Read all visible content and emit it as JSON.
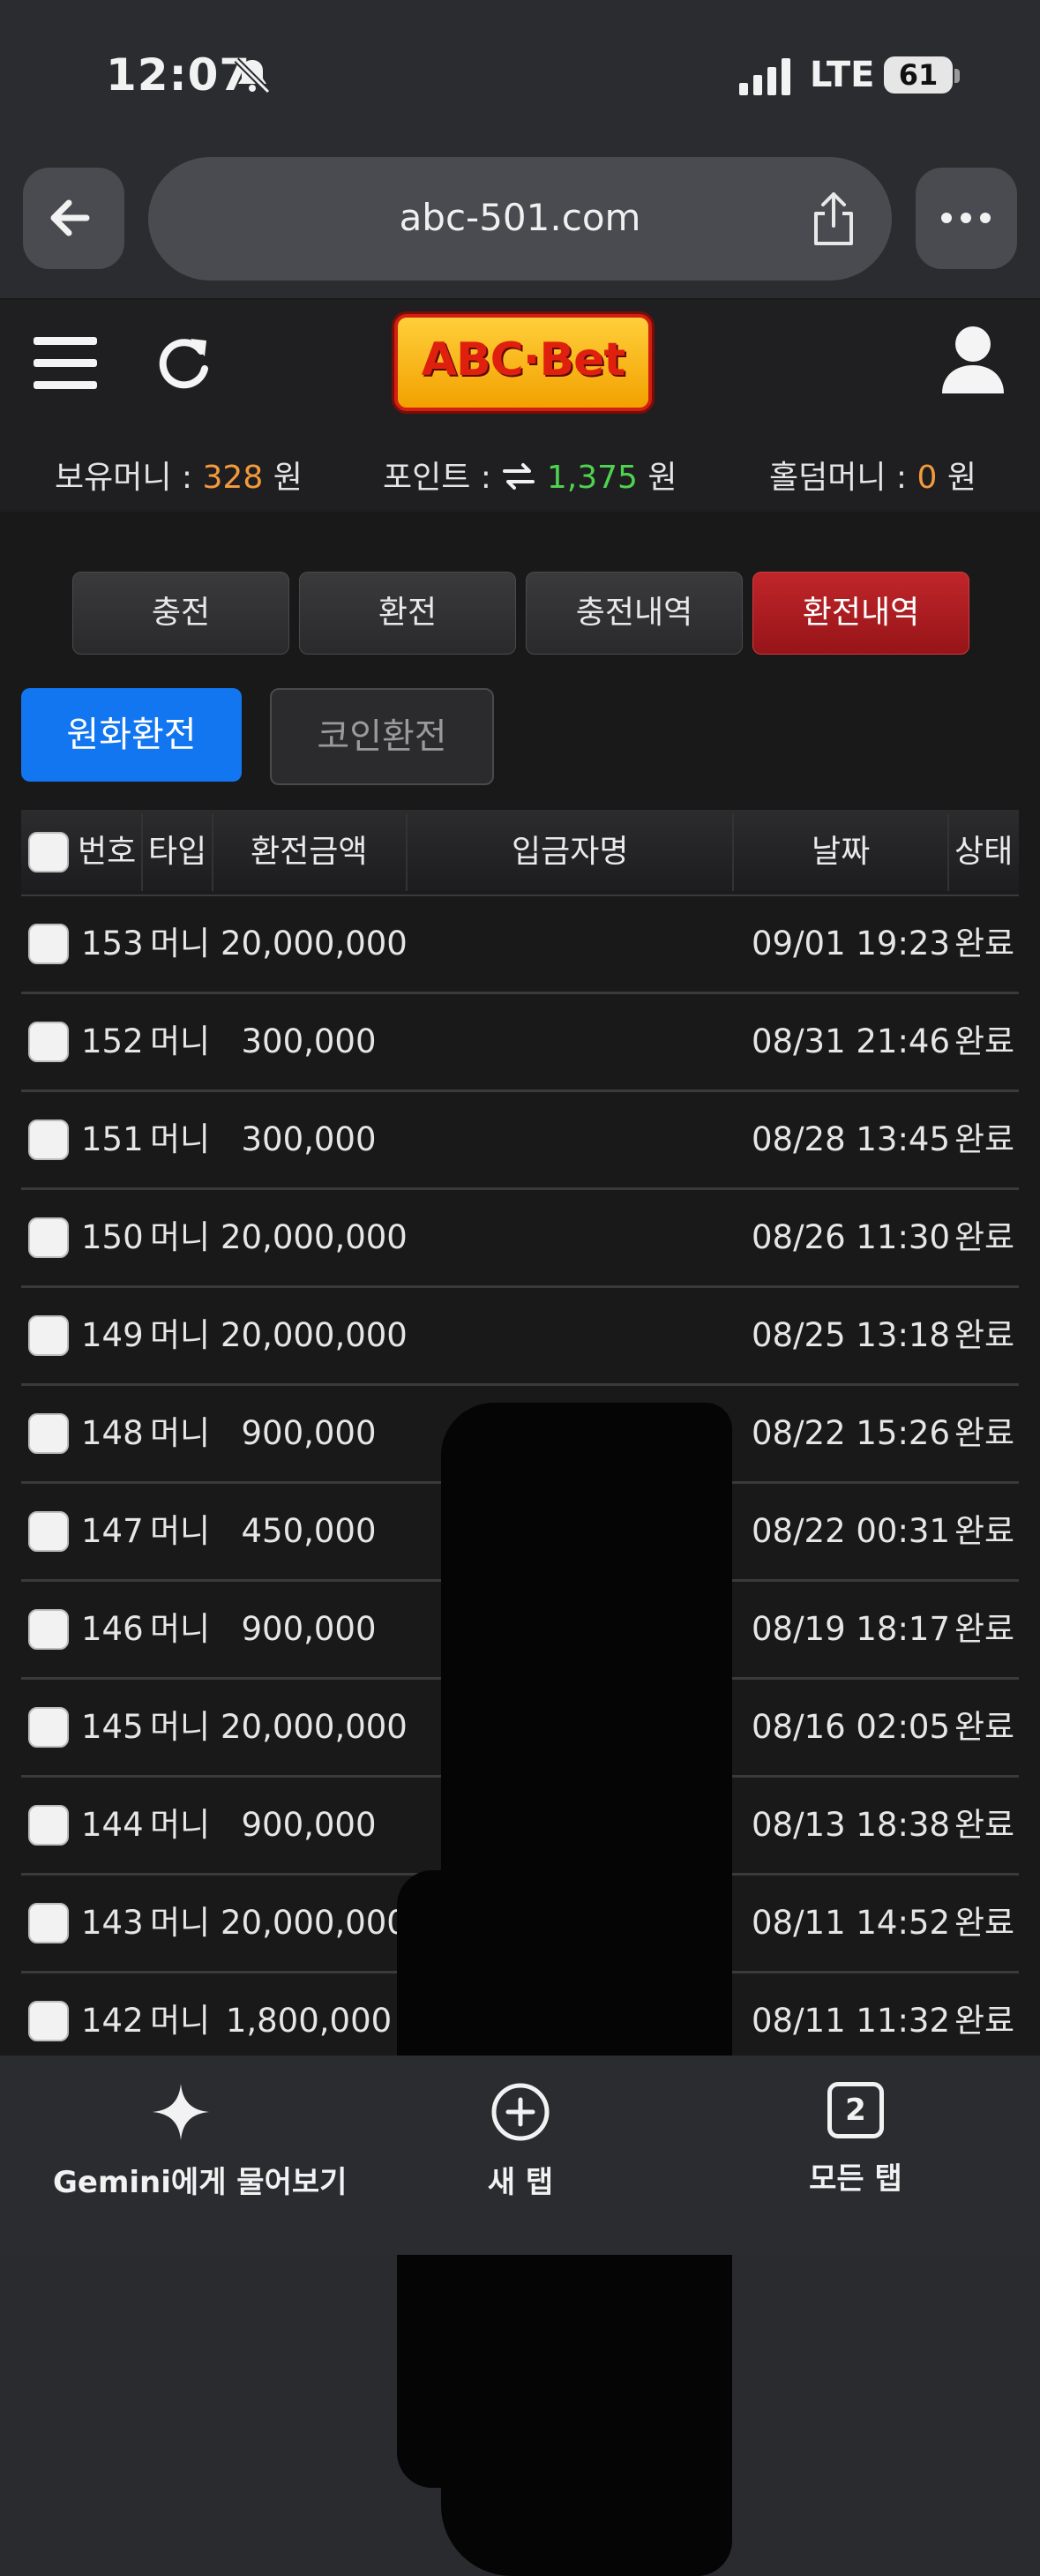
{
  "status_bar": {
    "time": "12:07",
    "network": "LTE",
    "battery": "61"
  },
  "browser": {
    "url": "abc-501.com"
  },
  "site": {
    "logo_text": "ABC·Bet",
    "balance": {
      "money_label": "보유머니 :",
      "money_value": "328",
      "points_label": "포인트 :",
      "points_value": "1,375",
      "holdem_label": "홀덤머니 :",
      "holdem_value": "0",
      "unit": "원"
    }
  },
  "tabs": [
    "충전",
    "환전",
    "충전내역",
    "환전내역"
  ],
  "subtabs": [
    "원화환전",
    "코인환전"
  ],
  "table": {
    "headers": {
      "no": "번호",
      "type": "타입",
      "amount": "환전금액",
      "depositor": "입금자명",
      "date": "날짜",
      "status": "상태"
    },
    "rows": [
      {
        "no": "153",
        "type": "머니",
        "amount": "20,000,000",
        "date": "09/01 19:23",
        "status": "완료"
      },
      {
        "no": "152",
        "type": "머니",
        "amount": "300,000",
        "date": "08/31 21:46",
        "status": "완료"
      },
      {
        "no": "151",
        "type": "머니",
        "amount": "300,000",
        "date": "08/28 13:45",
        "status": "완료"
      },
      {
        "no": "150",
        "type": "머니",
        "amount": "20,000,000",
        "date": "08/26 11:30",
        "status": "완료"
      },
      {
        "no": "149",
        "type": "머니",
        "amount": "20,000,000",
        "date": "08/25 13:18",
        "status": "완료"
      },
      {
        "no": "148",
        "type": "머니",
        "amount": "900,000",
        "date": "08/22 15:26",
        "status": "완료"
      },
      {
        "no": "147",
        "type": "머니",
        "amount": "450,000",
        "date": "08/22 00:31",
        "status": "완료"
      },
      {
        "no": "146",
        "type": "머니",
        "amount": "900,000",
        "date": "08/19 18:17",
        "status": "완료"
      },
      {
        "no": "145",
        "type": "머니",
        "amount": "20,000,000",
        "date": "08/16 02:05",
        "status": "완료"
      },
      {
        "no": "144",
        "type": "머니",
        "amount": "900,000",
        "date": "08/13 18:38",
        "status": "완료"
      },
      {
        "no": "143",
        "type": "머니",
        "amount": "20,000,000",
        "date": "08/11 14:52",
        "status": "완료"
      },
      {
        "no": "142",
        "type": "머니",
        "amount": "1,800,000",
        "date": "08/11 11:32",
        "status": "완료"
      }
    ]
  },
  "bottom_bar": {
    "gemini": "Gemini에게 물어보기",
    "new_tab": "새 탭",
    "tab_count": "2",
    "all_tabs": "모든 탭"
  },
  "colors": {
    "accent_blue": "#1276f0",
    "active_red": "#b01c20",
    "money_orange": "#f39a3c",
    "points_green": "#4fd24f"
  }
}
